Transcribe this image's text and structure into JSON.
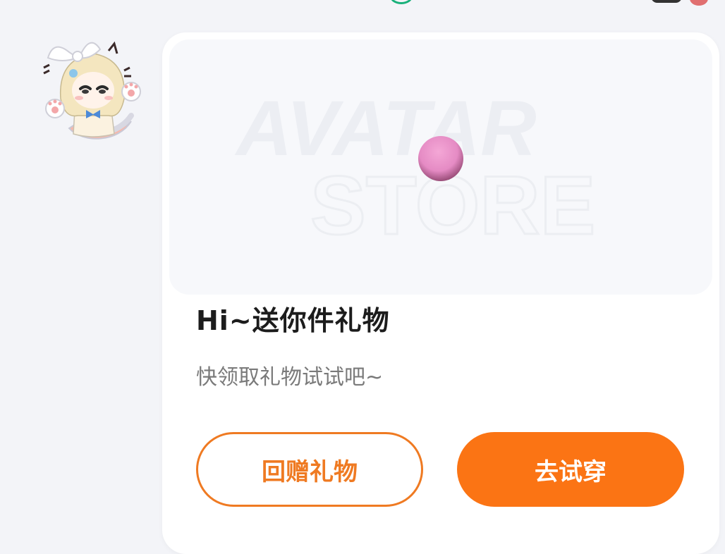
{
  "banner": {
    "watermark_line1": "AVATAR",
    "watermark_line2": "STORE"
  },
  "card": {
    "title": "Hi~送你件礼物",
    "subtitle": "快领取礼物试试吧~"
  },
  "buttons": {
    "return_gift": "回赠礼物",
    "try_on": "去试穿"
  },
  "colors": {
    "accent": "#fb7414",
    "accent_outline": "#ef7a22",
    "ball": "#e58bc4"
  },
  "icons": {
    "avatar": "anime-cat-girl-sticker"
  }
}
